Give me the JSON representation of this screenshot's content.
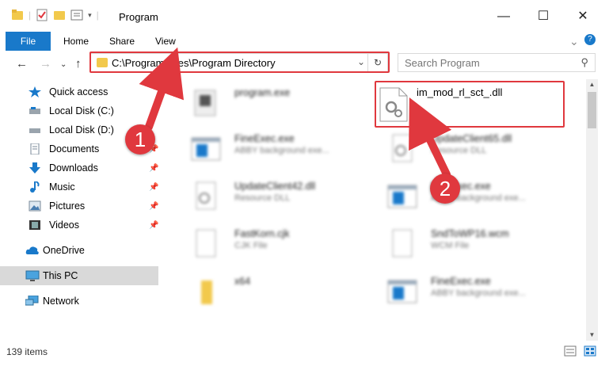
{
  "window": {
    "title": "Program",
    "minimize": "—",
    "maximize": "☐",
    "close": "✕"
  },
  "ribbon": {
    "tabs": [
      "File",
      "Home",
      "Share",
      "View"
    ],
    "help": "?",
    "expand": "⌄"
  },
  "nav": {
    "back": "←",
    "forward": "→",
    "dropdown": "⌄",
    "up": "↑"
  },
  "address": {
    "path": "C:\\Program Files\\Program Directory",
    "dropdown": "⌄",
    "refresh": "↻"
  },
  "search": {
    "placeholder": "Search Program",
    "icon": "⚲"
  },
  "sidebar": {
    "items": [
      {
        "label": "Quick access",
        "icon": "star-icon",
        "pinned": false
      },
      {
        "label": "Local Disk (C:)",
        "icon": "drive-icon",
        "pinned": false
      },
      {
        "label": "Local Disk (D:)",
        "icon": "drive-icon",
        "pinned": false
      },
      {
        "label": "Documents",
        "icon": "documents-icon",
        "pinned": true
      },
      {
        "label": "Downloads",
        "icon": "download-icon",
        "pinned": true
      },
      {
        "label": "Music",
        "icon": "music-icon",
        "pinned": true
      },
      {
        "label": "Pictures",
        "icon": "pictures-icon",
        "pinned": true
      },
      {
        "label": "Videos",
        "icon": "videos-icon",
        "pinned": true
      },
      {
        "label": "OneDrive",
        "icon": "cloud-icon",
        "pinned": false
      },
      {
        "label": "This PC",
        "icon": "computer-icon",
        "pinned": false,
        "selected": true
      },
      {
        "label": "Network",
        "icon": "network-icon",
        "pinned": false
      }
    ],
    "pin_glyph": "📌"
  },
  "files": [
    {
      "name": "program.exe",
      "type": "",
      "icon": "exe-icon"
    },
    {
      "name": "im_mod_rl_sct_.dll",
      "type": "",
      "icon": "dll-icon"
    },
    {
      "name": "FineExec.exe",
      "type": "ABBY background exe...",
      "icon": "app-window-icon"
    },
    {
      "name": "UpdateClient65.dll",
      "type": "Resource DLL",
      "icon": "dll-icon"
    },
    {
      "name": "UpdateClient42.dll",
      "type": "Resource DLL",
      "icon": "dll-icon"
    },
    {
      "name": "FineExec.exe",
      "type": "ABBY background exe...",
      "icon": "app-window-icon"
    },
    {
      "name": "FastKorn.cjk",
      "type": "CJK File",
      "icon": "blank-file-icon"
    },
    {
      "name": "SndToWP16.wcm",
      "type": "WCM File",
      "icon": "blank-file-icon"
    },
    {
      "name": "x64",
      "type": "",
      "icon": "folder-icon"
    },
    {
      "name": "FineExec.exe",
      "type": "ABBY background exe...",
      "icon": "app-window-icon"
    }
  ],
  "status": {
    "item_count": "139 items"
  },
  "callouts": [
    "1",
    "2"
  ],
  "colors": {
    "accent": "#1979ca",
    "highlight": "#e0383e",
    "selected": "#d9d9d9"
  }
}
